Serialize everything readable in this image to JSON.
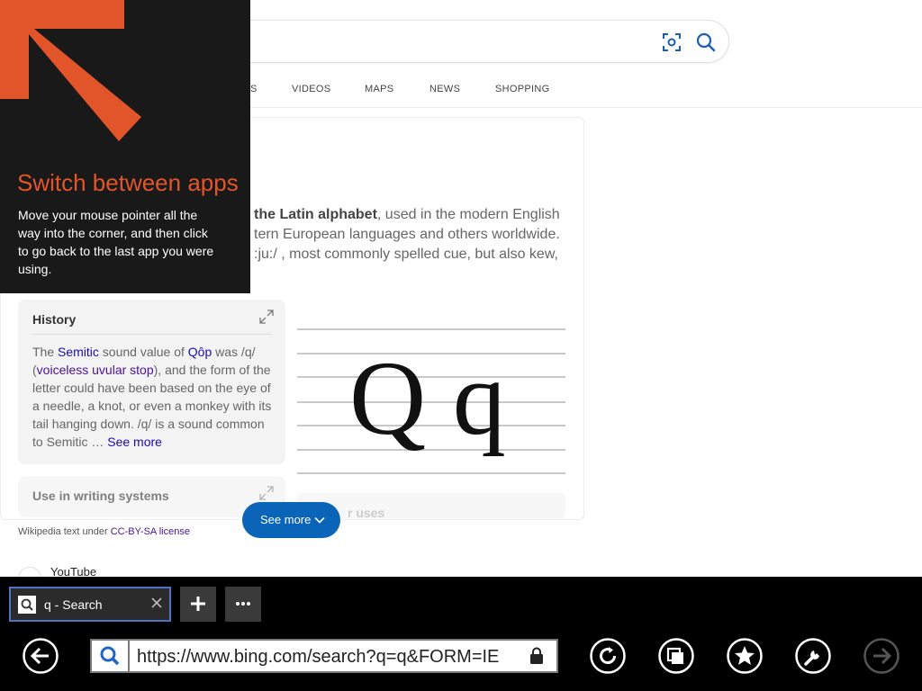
{
  "search": {
    "tabs": [
      "S",
      "VIDEOS",
      "MAPS",
      "NEWS",
      "SHOPPING"
    ]
  },
  "card": {
    "desc_lines": [
      [
        "the Latin alphabet",
        ", used in the modern English"
      ],
      [
        "",
        "tern European languages and others worldwide."
      ],
      [
        "",
        ":ju:/ , most commonly spelled cue, but also kew,"
      ]
    ],
    "history": {
      "title": "History",
      "lines": [
        [
          "The ",
          "Semitic",
          " sound value of ",
          "Qôp",
          " was /q/"
        ],
        [
          "(",
          "voiceless uvular stop",
          "), and the form of the"
        ],
        [
          "letter could have been based on the eye of"
        ],
        [
          "a needle, a knot, or even a monkey with its"
        ],
        [
          "tail hanging down. /q/ is a sound common"
        ],
        [
          "to Semitic … ",
          "See more"
        ]
      ]
    },
    "writing_title": "Use in writing systems",
    "image_letters": "Q q",
    "other_uses": "r uses",
    "see_more_button": "See more",
    "license_prefix": "Wikipedia text under ",
    "license_link": "CC-BY-SA license",
    "next_result": "YouTube"
  },
  "charm": {
    "heading": "Switch between apps",
    "text_lines": [
      "Move your mouse pointer all the",
      "way into the corner, and then click",
      "to go back to the last app you were",
      "using."
    ],
    "accent_color": "#e2552b"
  },
  "appbar": {
    "tab_label": "q - Search",
    "url": "https://www.bing.com/search?q=q&FORM=IE",
    "buttons": [
      "back-icon",
      "refresh-icon",
      "tabs-icon",
      "favorites-icon",
      "tools-icon",
      "forward-icon"
    ]
  }
}
